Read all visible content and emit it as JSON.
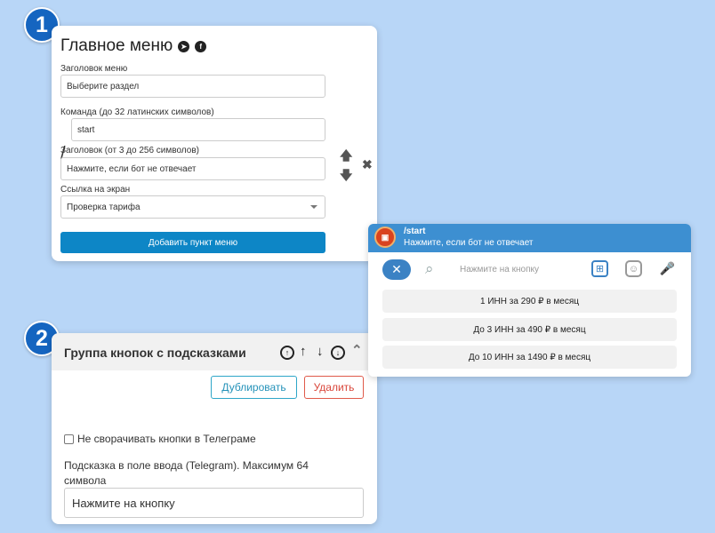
{
  "badges": {
    "one": "1",
    "two": "2"
  },
  "menu": {
    "title": "Главное меню",
    "telegram_icon": "telegram-icon",
    "facebook_icon": "facebook-icon",
    "menu_title_label": "Заголовок меню",
    "menu_title_value": "Выберите раздел",
    "command_label": "Команда (до 32 латинских символов)",
    "command_prefix": "/",
    "command_value": "start",
    "header_label": "Заголовок (от 3 до 256 символов)",
    "header_value": "Нажмите, если бот не отвечает",
    "link_label": "Ссылка на экран",
    "link_value": "Проверка тарифа",
    "add_button": "Добавить пункт меню",
    "up_icon": "🡅",
    "down_icon": "🡇",
    "remove_icon": "✖"
  },
  "group": {
    "title": "Группа кнопок с подсказками",
    "duplicate_button": "Дублировать",
    "delete_button": "Удалить",
    "checkbox_label": "Не сворачивать кнопки в Телеграме",
    "checkbox_checked": false,
    "hint_label": "Подсказка в поле ввода (Telegram). Максимум 64 символа",
    "hint_value": "Нажмите на кнопку"
  },
  "telegram": {
    "command": "/start",
    "subtitle": "Нажмите, если бот не отвечает",
    "input_placeholder": "Нажмите на кнопку",
    "keyboard": [
      "1 ИНН за 290 ₽ в месяц",
      "До 3 ИНН за 490 ₽ в месяц",
      "До 10 ИНН за 1490 ₽ в месяц"
    ],
    "colors": {
      "accent": "#3d8fd1",
      "button": "#0d86c6"
    }
  }
}
